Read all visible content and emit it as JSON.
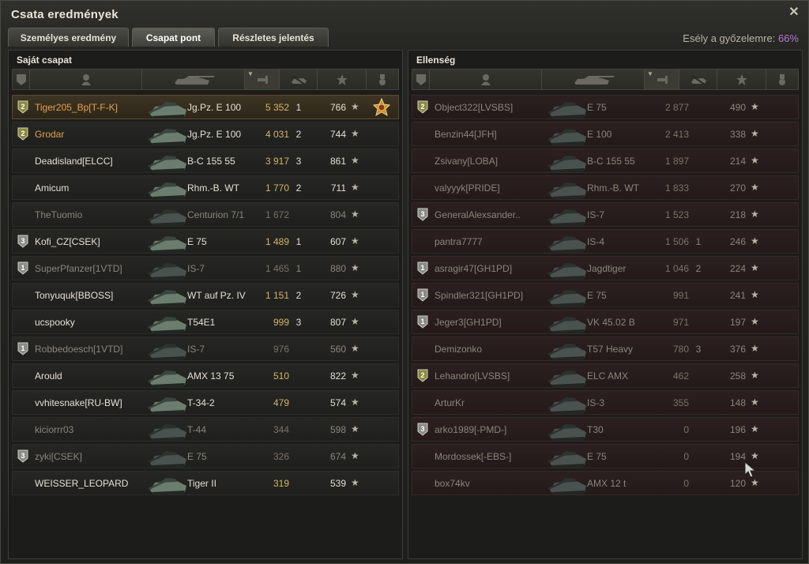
{
  "window": {
    "title": "Csata eredmények"
  },
  "tabs": [
    {
      "label": "Személyes eredmény",
      "active": false
    },
    {
      "label": "Csapat pont",
      "active": true
    },
    {
      "label": "Részletes jelentés",
      "active": false
    }
  ],
  "chance": {
    "label": "Esély a győzelemre: ",
    "value": "66%"
  },
  "colors": {
    "squad_name": "#e5a04c",
    "damage": "#d5b46a",
    "win_chance": "#b07ad8"
  },
  "own_team": {
    "title": "Saját csapat",
    "rows": [
      {
        "name": "Tiger205_Bp[T-F-K]",
        "vehicle": "Jg.Pz. E 100",
        "damage": "5 352",
        "kills": "1",
        "xp": "766",
        "badge": "2",
        "squad": true,
        "me": true,
        "dead": false,
        "medal": true
      },
      {
        "name": "Grodar",
        "vehicle": "Jg.Pz. E 100",
        "damage": "4 031",
        "kills": "2",
        "xp": "744",
        "badge": "2",
        "squad": true,
        "me": false,
        "dead": false
      },
      {
        "name": "Deadisland[ELCC]",
        "vehicle": "B-C 155 55",
        "damage": "3 917",
        "kills": "3",
        "xp": "861",
        "badge": "",
        "squad": false,
        "dead": false
      },
      {
        "name": "Amicum",
        "vehicle": "Rhm.-B. WT",
        "damage": "1 770",
        "kills": "2",
        "xp": "711",
        "badge": "",
        "squad": false,
        "dead": false
      },
      {
        "name": "TheTuomio",
        "vehicle": "Centurion 7/1",
        "damage": "1 672",
        "kills": "",
        "xp": "804",
        "badge": "",
        "squad": false,
        "dead": true
      },
      {
        "name": "Kofi_CZ[CSEK]",
        "vehicle": "E 75",
        "damage": "1 489",
        "kills": "1",
        "xp": "607",
        "badge": "3",
        "squad": false,
        "dead": false
      },
      {
        "name": "SuperPfanzer[1VTD]",
        "vehicle": "IS-7",
        "damage": "1 465",
        "kills": "1",
        "xp": "880",
        "badge": "1",
        "squad": false,
        "dead": true
      },
      {
        "name": "Tonyuquk[BBOSS]",
        "vehicle": "WT auf Pz. IV",
        "damage": "1 151",
        "kills": "2",
        "xp": "726",
        "badge": "",
        "squad": false,
        "dead": false
      },
      {
        "name": "ucspooky",
        "vehicle": "T54E1",
        "damage": "999",
        "kills": "3",
        "xp": "807",
        "badge": "",
        "squad": false,
        "dead": false
      },
      {
        "name": "Robbedoesch[1VTD]",
        "vehicle": "IS-7",
        "damage": "976",
        "kills": "",
        "xp": "560",
        "badge": "1",
        "squad": false,
        "dead": true
      },
      {
        "name": "Arould",
        "vehicle": "AMX 13 75",
        "damage": "510",
        "kills": "",
        "xp": "822",
        "badge": "",
        "squad": false,
        "dead": false
      },
      {
        "name": "vvhitesnake[RU-BW]",
        "vehicle": "T-34-2",
        "damage": "479",
        "kills": "",
        "xp": "574",
        "badge": "",
        "squad": false,
        "dead": false
      },
      {
        "name": "kiciorrr03",
        "vehicle": "T-44",
        "damage": "344",
        "kills": "",
        "xp": "598",
        "badge": "",
        "squad": false,
        "dead": true
      },
      {
        "name": "zyki[CSEK]",
        "vehicle": "E 75",
        "damage": "326",
        "kills": "",
        "xp": "674",
        "badge": "3",
        "squad": false,
        "dead": true
      },
      {
        "name": "WEISSER_LEOPARD",
        "vehicle": "Tiger II",
        "damage": "319",
        "kills": "",
        "xp": "539",
        "badge": "",
        "squad": false,
        "dead": false
      }
    ]
  },
  "enemy_team": {
    "title": "Ellenség",
    "rows": [
      {
        "name": "Object322[LVSBS]",
        "vehicle": "E 75",
        "damage": "2 877",
        "kills": "",
        "xp": "490",
        "badge": "2",
        "dead": true
      },
      {
        "name": "Benzin44[JFH]",
        "vehicle": "E 100",
        "damage": "2 413",
        "kills": "",
        "xp": "338",
        "badge": "",
        "dead": true
      },
      {
        "name": "Zsivany[LOBA]",
        "vehicle": "B-C 155 55",
        "damage": "1 897",
        "kills": "",
        "xp": "214",
        "badge": "",
        "dead": true
      },
      {
        "name": "valyyyk[PRIDE]",
        "vehicle": "Rhm.-B. WT",
        "damage": "1 833",
        "kills": "",
        "xp": "270",
        "badge": "",
        "dead": true
      },
      {
        "name": "GeneralAlexsander..",
        "vehicle": "IS-7",
        "damage": "1 523",
        "kills": "",
        "xp": "218",
        "badge": "3",
        "dead": true
      },
      {
        "name": "pantra7777",
        "vehicle": "IS-4",
        "damage": "1 506",
        "kills": "1",
        "xp": "246",
        "badge": "",
        "dead": true
      },
      {
        "name": "asragir47[GH1PD]",
        "vehicle": "Jagdtiger",
        "damage": "1 046",
        "kills": "2",
        "xp": "224",
        "badge": "1",
        "dead": true
      },
      {
        "name": "Spindler321[GH1PD]",
        "vehicle": "E 75",
        "damage": "991",
        "kills": "",
        "xp": "241",
        "badge": "1",
        "dead": true
      },
      {
        "name": "Jeger3[GH1PD]",
        "vehicle": "VK 45.02 B",
        "damage": "971",
        "kills": "",
        "xp": "197",
        "badge": "1",
        "dead": true
      },
      {
        "name": "Demizonko",
        "vehicle": "T57 Heavy",
        "damage": "780",
        "kills": "3",
        "xp": "376",
        "badge": "",
        "dead": true
      },
      {
        "name": "Lehandro[LVSBS]",
        "vehicle": "ELC AMX",
        "damage": "462",
        "kills": "",
        "xp": "258",
        "badge": "2",
        "dead": true
      },
      {
        "name": "ArturKr",
        "vehicle": "IS-3",
        "damage": "355",
        "kills": "",
        "xp": "148",
        "badge": "",
        "dead": true
      },
      {
        "name": "arko1989[-PMD-]",
        "vehicle": "T30",
        "damage": "0",
        "kills": "",
        "xp": "196",
        "badge": "3",
        "dead": true
      },
      {
        "name": "Mordossek[-EBS-]",
        "vehicle": "E 75",
        "damage": "0",
        "kills": "",
        "xp": "194",
        "badge": "",
        "dead": true
      },
      {
        "name": "box74kv",
        "vehicle": "AMX 12 t",
        "damage": "0",
        "kills": "",
        "xp": "120",
        "badge": "",
        "dead": true
      }
    ]
  },
  "columns": [
    {
      "icon": "badge-column-icon"
    },
    {
      "icon": "player-column-icon"
    },
    {
      "icon": "tank-column-icon"
    },
    {
      "icon": "damage-column-icon",
      "sorted": true
    },
    {
      "icon": "kills-column-icon"
    },
    {
      "icon": "xp-column-icon"
    },
    {
      "icon": "medal-column-icon"
    }
  ]
}
